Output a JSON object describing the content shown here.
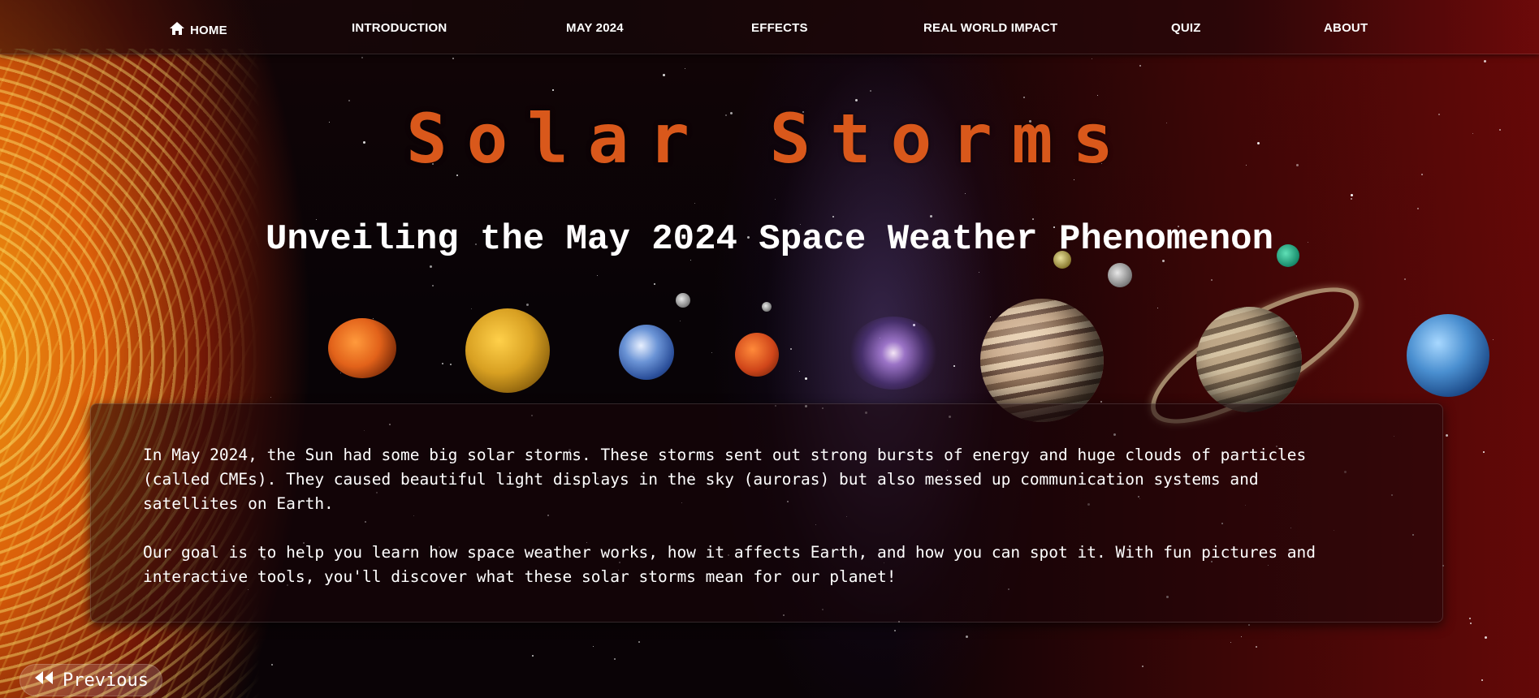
{
  "nav": {
    "items": [
      {
        "label": "HOME",
        "icon": "home-icon"
      },
      {
        "label": "INTRODUCTION"
      },
      {
        "label": "MAY 2024"
      },
      {
        "label": "EFFECTS"
      },
      {
        "label": "REAL WORLD IMPACT"
      },
      {
        "label": "QUIZ"
      },
      {
        "label": "ABOUT"
      }
    ]
  },
  "hero": {
    "title": "Solar Storms",
    "subtitle": "Unveiling the May 2024 Space Weather Phenomenon"
  },
  "content": {
    "paragraphs": [
      "In May 2024, the Sun had some big solar storms. These storms sent out strong bursts of energy and huge clouds of particles (called CMEs). They caused beautiful light displays in the sky (auroras) but also messed up communication systems and satellites on Earth.",
      "Our goal is to help you learn how space weather works, how it affects Earth, and how you can spot it. With fun pictures and interactive tools, you'll discover what these solar storms mean for our planet!"
    ]
  },
  "pagination": {
    "previous_label": "Previous",
    "previous_icon": "double-chevron-left-icon"
  },
  "colors": {
    "title": "#d9581b",
    "text": "#ffffff"
  }
}
